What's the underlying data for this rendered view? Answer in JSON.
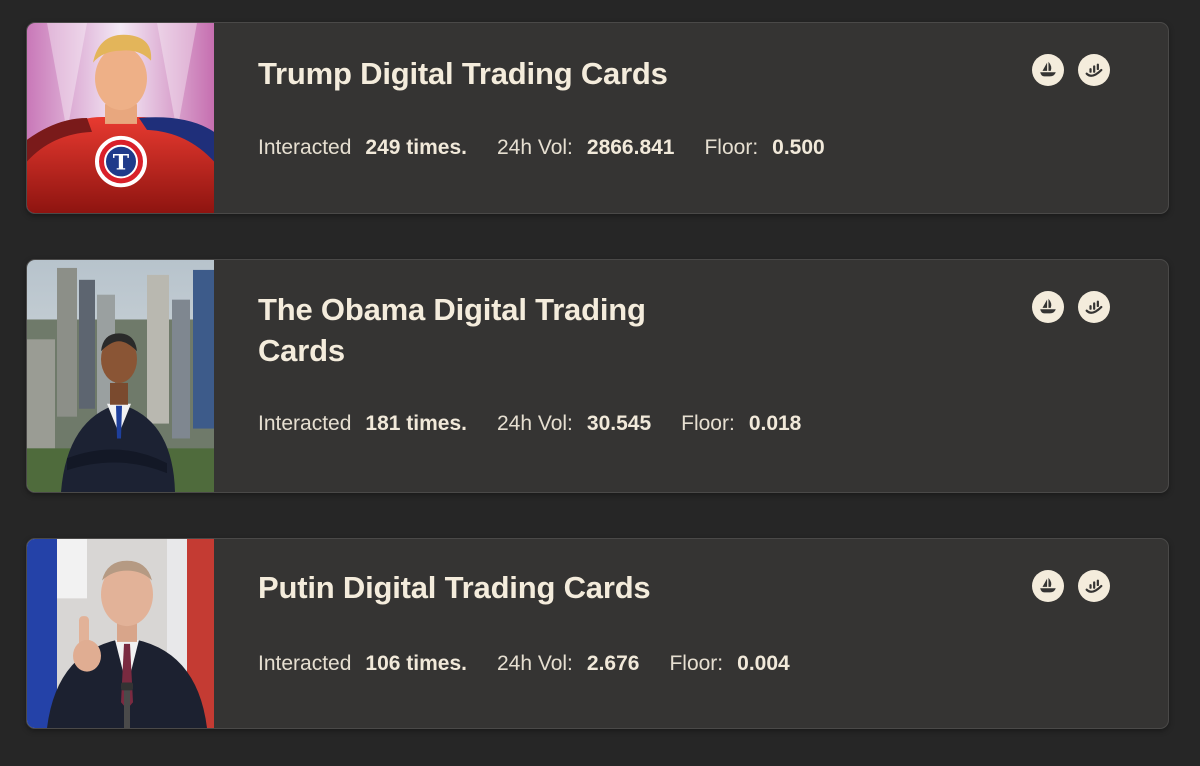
{
  "collections": [
    {
      "title": "Trump Digital Trading Cards",
      "interacted_label": "Interacted",
      "interacted_value": "249 times.",
      "vol_label": "24h Vol:",
      "vol_value": "2866.841",
      "floor_label": "Floor:",
      "floor_value": "0.500",
      "thumbnail_icon": "trump-superhero-card-image"
    },
    {
      "title": "The Obama Digital Trading Cards",
      "interacted_label": "Interacted",
      "interacted_value": "181 times.",
      "vol_label": "24h Vol:",
      "vol_value": "30.545",
      "floor_label": "Floor:",
      "floor_value": "0.018",
      "thumbnail_icon": "obama-city-card-image"
    },
    {
      "title": "Putin Digital Trading Cards",
      "interacted_label": "Interacted",
      "interacted_value": "106 times.",
      "vol_label": "24h Vol:",
      "vol_value": "2.676",
      "floor_label": "Floor:",
      "floor_value": "0.004",
      "thumbnail_icon": "putin-podium-card-image"
    }
  ],
  "card_actions": [
    "opensea-icon",
    "chart-icon"
  ],
  "colors": {
    "page_background": "#262626",
    "card_background": "#353433",
    "text_cream": "#f4ecdc"
  }
}
